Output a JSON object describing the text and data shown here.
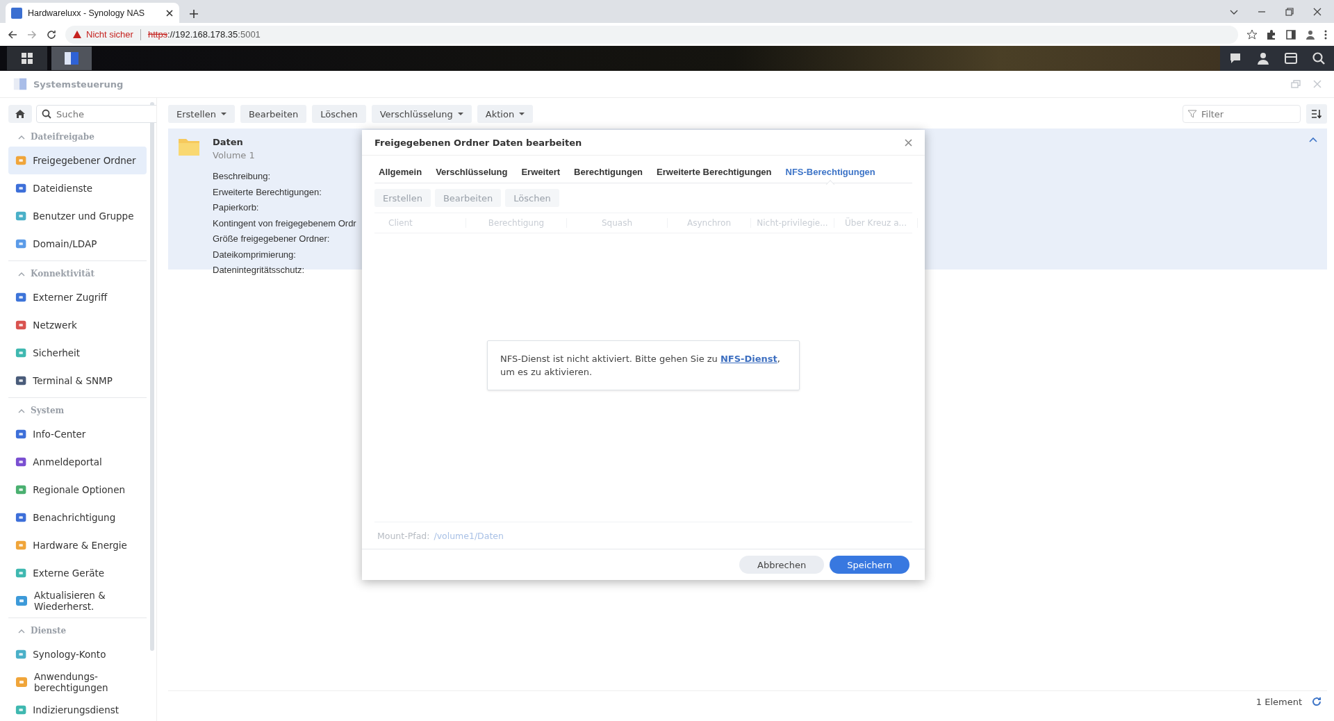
{
  "browser": {
    "tab_title": "Hardwareluxx - Synology NAS",
    "security": "Nicht sicher",
    "url_scheme": "https",
    "url_host": "://192.168.178.35",
    "url_port": ":5001"
  },
  "window": {
    "title": "Systemsteuerung"
  },
  "sidebar": {
    "search": {
      "placeholder": "Suche"
    },
    "sections": [
      {
        "title": "Dateifreigabe",
        "expanded": true,
        "items": [
          {
            "label": "Freigegebener Ordner",
            "selected": true
          },
          {
            "label": "Dateidienste",
            "selected": false
          },
          {
            "label": "Benutzer und Gruppe",
            "selected": false
          },
          {
            "label": "Domain/LDAP",
            "selected": false
          }
        ]
      },
      {
        "title": "Konnektivität",
        "expanded": true,
        "items": [
          {
            "label": "Externer Zugriff",
            "selected": false
          },
          {
            "label": "Netzwerk",
            "selected": false
          },
          {
            "label": "Sicherheit",
            "selected": false
          },
          {
            "label": "Terminal & SNMP",
            "selected": false
          }
        ]
      },
      {
        "title": "System",
        "expanded": true,
        "items": [
          {
            "label": "Info-Center",
            "selected": false
          },
          {
            "label": "Anmeldeportal",
            "selected": false
          },
          {
            "label": "Regionale Optionen",
            "selected": false
          },
          {
            "label": "Benachrichtigung",
            "selected": false
          },
          {
            "label": "Hardware & Energie",
            "selected": false
          },
          {
            "label": "Externe Geräte",
            "selected": false
          },
          {
            "label": "Aktualisieren & Wiederherst.",
            "selected": false
          }
        ]
      },
      {
        "title": "Dienste",
        "expanded": true,
        "items": [
          {
            "label": "Synology-Konto",
            "selected": false
          },
          {
            "label": "Anwendungs-berechtigungen",
            "selected": false
          },
          {
            "label": "Indizierungsdienst",
            "selected": false
          }
        ]
      }
    ]
  },
  "toolbar": {
    "buttons": [
      {
        "label": "Erstellen",
        "dropdown": true
      },
      {
        "label": "Bearbeiten",
        "dropdown": false
      },
      {
        "label": "Löschen",
        "dropdown": false
      },
      {
        "label": "Verschlüsselung",
        "dropdown": true
      },
      {
        "label": "Aktion",
        "dropdown": true
      }
    ],
    "filter": {
      "placeholder": "Filter"
    }
  },
  "folder": {
    "name": "Daten",
    "volume": "Volume 1",
    "expanded": true,
    "fields": [
      "Beschreibung:",
      "Erweiterte Berechtigungen:",
      "Papierkorb:",
      "Kontingent von freigegebenem Ordr",
      "Größe freigegebener Ordner:",
      "Dateikomprimierung:",
      "Datenintegritätsschutz:"
    ]
  },
  "dialog": {
    "title": "Freigegebenen Ordner Daten bearbeiten",
    "tabs": [
      {
        "label": "Allgemein",
        "selected": false
      },
      {
        "label": "Verschlüsselung",
        "selected": false
      },
      {
        "label": "Erweitert",
        "selected": false
      },
      {
        "label": "Berechtigungen",
        "selected": false
      },
      {
        "label": "Erweiterte Berechtigungen",
        "selected": false
      },
      {
        "label": "NFS-Berechtigungen",
        "selected": true
      }
    ],
    "buttons": [
      {
        "label": "Erstellen",
        "disabled": true
      },
      {
        "label": "Bearbeiten",
        "disabled": true
      },
      {
        "label": "Löschen",
        "disabled": true
      }
    ],
    "columns": [
      "Client",
      "Berechtigung",
      "Squash",
      "Asynchron",
      "Nicht-privilegie...",
      "Über Kreuz a..."
    ],
    "notice": {
      "before": "NFS-Dienst ist nicht aktiviert. Bitte gehen Sie zu ",
      "link": "NFS-Dienst",
      "after": ", um es zu aktivieren."
    },
    "mount_label": "Mount-Pfad:",
    "mount_path": "/volume1/Daten",
    "footer": [
      {
        "label": "Abbrechen",
        "kind": "secondary"
      },
      {
        "label": "Speichern",
        "kind": "primary"
      }
    ]
  },
  "status": {
    "count": "1 Element"
  }
}
